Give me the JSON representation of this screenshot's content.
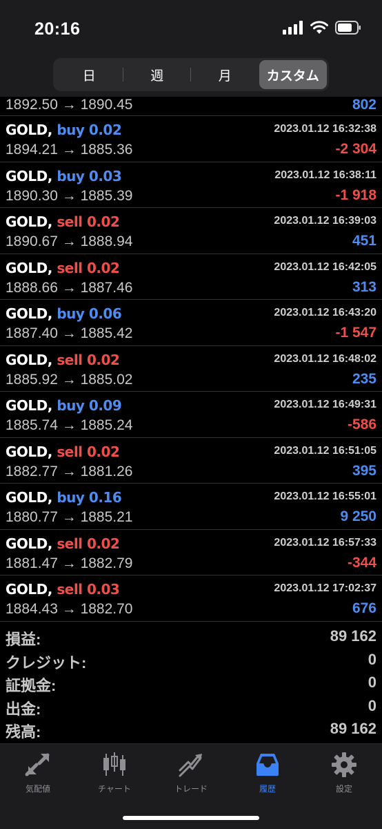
{
  "status": {
    "time": "20:16"
  },
  "segments": [
    {
      "label": "日",
      "active": false
    },
    {
      "label": "週",
      "active": false
    },
    {
      "label": "月",
      "active": false
    },
    {
      "label": "カスタム",
      "active": true
    }
  ],
  "partial_row": {
    "prices": "1892.50 → 1890.45",
    "profit": "802"
  },
  "trades": [
    {
      "symbol": "GOLD,",
      "action": "buy 0.02",
      "time": "2023.01.12 16:32:38",
      "prices": "1894.21 → 1885.36",
      "profit": "-2 304"
    },
    {
      "symbol": "GOLD,",
      "action": "buy 0.03",
      "time": "2023.01.12 16:38:11",
      "prices": "1890.30 → 1885.39",
      "profit": "-1 918"
    },
    {
      "symbol": "GOLD,",
      "action": "sell 0.02",
      "time": "2023.01.12 16:39:03",
      "prices": "1890.67 → 1888.94",
      "profit": "451"
    },
    {
      "symbol": "GOLD,",
      "action": "sell 0.02",
      "time": "2023.01.12 16:42:05",
      "prices": "1888.66 → 1887.46",
      "profit": "313"
    },
    {
      "symbol": "GOLD,",
      "action": "buy 0.06",
      "time": "2023.01.12 16:43:20",
      "prices": "1887.40 → 1885.42",
      "profit": "-1 547"
    },
    {
      "symbol": "GOLD,",
      "action": "sell 0.02",
      "time": "2023.01.12 16:48:02",
      "prices": "1885.92 → 1885.02",
      "profit": "235"
    },
    {
      "symbol": "GOLD,",
      "action": "buy 0.09",
      "time": "2023.01.12 16:49:31",
      "prices": "1885.74 → 1885.24",
      "profit": "-586"
    },
    {
      "symbol": "GOLD,",
      "action": "sell 0.02",
      "time": "2023.01.12 16:51:05",
      "prices": "1882.77 → 1881.26",
      "profit": "395"
    },
    {
      "symbol": "GOLD,",
      "action": "buy 0.16",
      "time": "2023.01.12 16:55:01",
      "prices": "1880.77 → 1885.21",
      "profit": "9 250"
    },
    {
      "symbol": "GOLD,",
      "action": "sell 0.02",
      "time": "2023.01.12 16:57:33",
      "prices": "1881.47 → 1882.79",
      "profit": "-344"
    },
    {
      "symbol": "GOLD,",
      "action": "sell 0.03",
      "time": "2023.01.12 17:02:37",
      "prices": "1884.43 → 1882.70",
      "profit": "676"
    }
  ],
  "summary": [
    {
      "label": "損益:",
      "value": "89 162"
    },
    {
      "label": "クレジット:",
      "value": "0"
    },
    {
      "label": "証拠金:",
      "value": "0"
    },
    {
      "label": "出金:",
      "value": "0"
    },
    {
      "label": "残高:",
      "value": "89 162"
    }
  ],
  "tabs": [
    {
      "label": "気配値",
      "icon": "quotes-icon",
      "active": false
    },
    {
      "label": "チャート",
      "icon": "chart-icon",
      "active": false
    },
    {
      "label": "トレード",
      "icon": "trade-icon",
      "active": false
    },
    {
      "label": "履歴",
      "icon": "history-icon",
      "active": true
    },
    {
      "label": "設定",
      "icon": "settings-icon",
      "active": false
    }
  ],
  "colors": {
    "buy": "#4e8cf0",
    "sell": "#ef4f48",
    "profit_pos": "#4e8cf0",
    "profit_neg": "#ef4f48",
    "active_tab": "#3b82f6"
  }
}
